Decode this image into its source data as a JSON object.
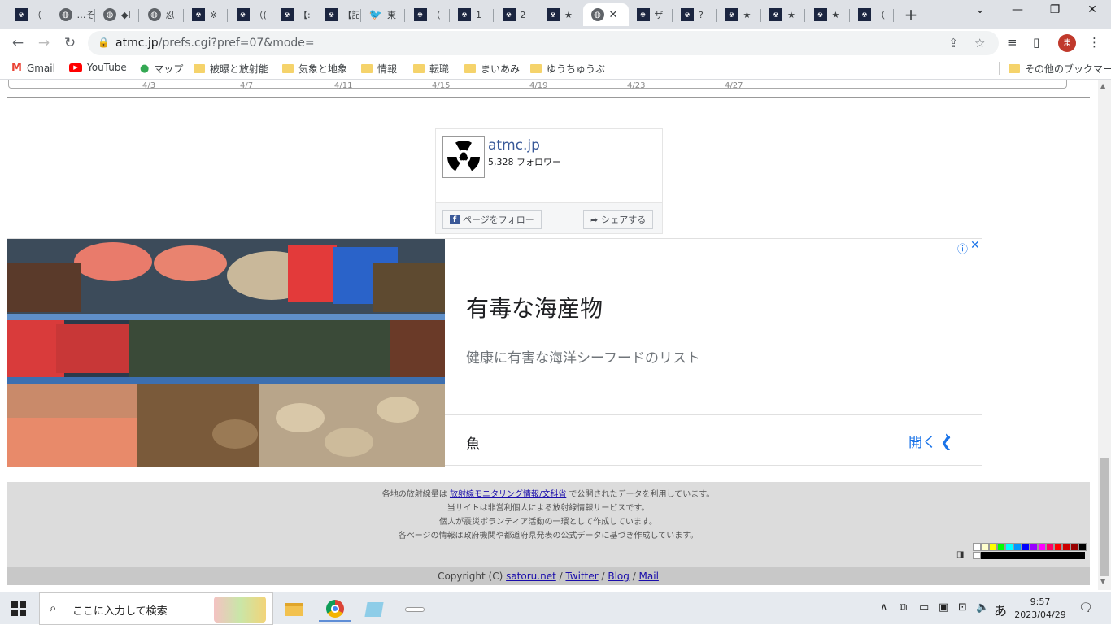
{
  "browser": {
    "tabs": [
      {
        "title": "（",
        "icon": "atmc"
      },
      {
        "title": "…そ",
        "icon": "globe"
      },
      {
        "title": "◆I",
        "icon": "globe"
      },
      {
        "title": "忍",
        "icon": "globe"
      },
      {
        "title": "※",
        "icon": "atmc"
      },
      {
        "title": "（(",
        "icon": "atmc"
      },
      {
        "title": "【:",
        "icon": "atmc"
      },
      {
        "title": "【記",
        "icon": "atmc"
      },
      {
        "title": "東",
        "icon": "twitter"
      },
      {
        "title": "（",
        "icon": "atmc"
      },
      {
        "title": "1",
        "icon": "atmc"
      },
      {
        "title": "2",
        "icon": "atmc"
      },
      {
        "title": "★",
        "icon": "atmc"
      },
      {
        "title": "",
        "icon": "globe",
        "active": true
      },
      {
        "title": "ザ",
        "icon": "atmc"
      },
      {
        "title": "?",
        "icon": "atmc"
      },
      {
        "title": "★",
        "icon": "atmc"
      },
      {
        "title": "★",
        "icon": "atmc"
      },
      {
        "title": "★",
        "icon": "atmc"
      },
      {
        "title": "（",
        "icon": "atmc"
      }
    ],
    "url_host": "atmc.jp",
    "url_path": "/prefs.cgi?pref=07&mode=",
    "profile_initial": "ま",
    "bookmarks": [
      {
        "label": "Gmail",
        "icon": "gmail"
      },
      {
        "label": "YouTube",
        "icon": "youtube"
      },
      {
        "label": "マップ",
        "icon": "maps"
      },
      {
        "label": "被曝と放射能",
        "icon": "folder"
      },
      {
        "label": "気象と地象",
        "icon": "folder"
      },
      {
        "label": "情報",
        "icon": "folder"
      },
      {
        "label": "転職",
        "icon": "folder"
      },
      {
        "label": "まいあみ",
        "icon": "folder"
      },
      {
        "label": "ゆうちゅうぶ",
        "icon": "folder"
      }
    ],
    "other_bookmarks": "その他のブックマーク"
  },
  "chart_axis": {
    "tick_labels": [
      "4/3",
      "4/7",
      "4/11",
      "4/15",
      "4/19",
      "4/23",
      "4/27"
    ]
  },
  "facebook": {
    "page_name": "atmc.jp",
    "followers": "5,328 フォロワー",
    "follow_label": "ページをフォロー",
    "share_label": "シェアする"
  },
  "ad": {
    "headline": "有毒な海産物",
    "subtitle": "健康に有害な海洋シーフードのリスト",
    "category": "魚",
    "open_label": "開く"
  },
  "footer": {
    "line1_pre": "各地の放射線量は ",
    "line1_link": "放射線モニタリング情報/文科省",
    "line1_post": " で公開されたデータを利用しています。",
    "line2": "当サイトは非営利個人による放射線情報サービスです。",
    "line3": "個人が震災ボランティア活動の一環として作成しています。",
    "line4": "各ページの情報は政府機関や都道府県発表の公式データに基づき作成しています。",
    "copyright_pre": "Copyright (C) ",
    "links": [
      "satoru.net",
      "Twitter",
      "Blog",
      "Mail"
    ],
    "palette_colors": [
      "#ffffff",
      "#ffffcc",
      "#ffff00",
      "#00ff00",
      "#00ffff",
      "#0099ff",
      "#0000ff",
      "#9900ff",
      "#ff00ff",
      "#ff0066",
      "#ff0000",
      "#cc0000",
      "#990000",
      "#000000"
    ]
  },
  "taskbar": {
    "search_placeholder": "ここに入力して検索",
    "ime": "あ",
    "time": "9:57",
    "date": "2023/04/29"
  }
}
